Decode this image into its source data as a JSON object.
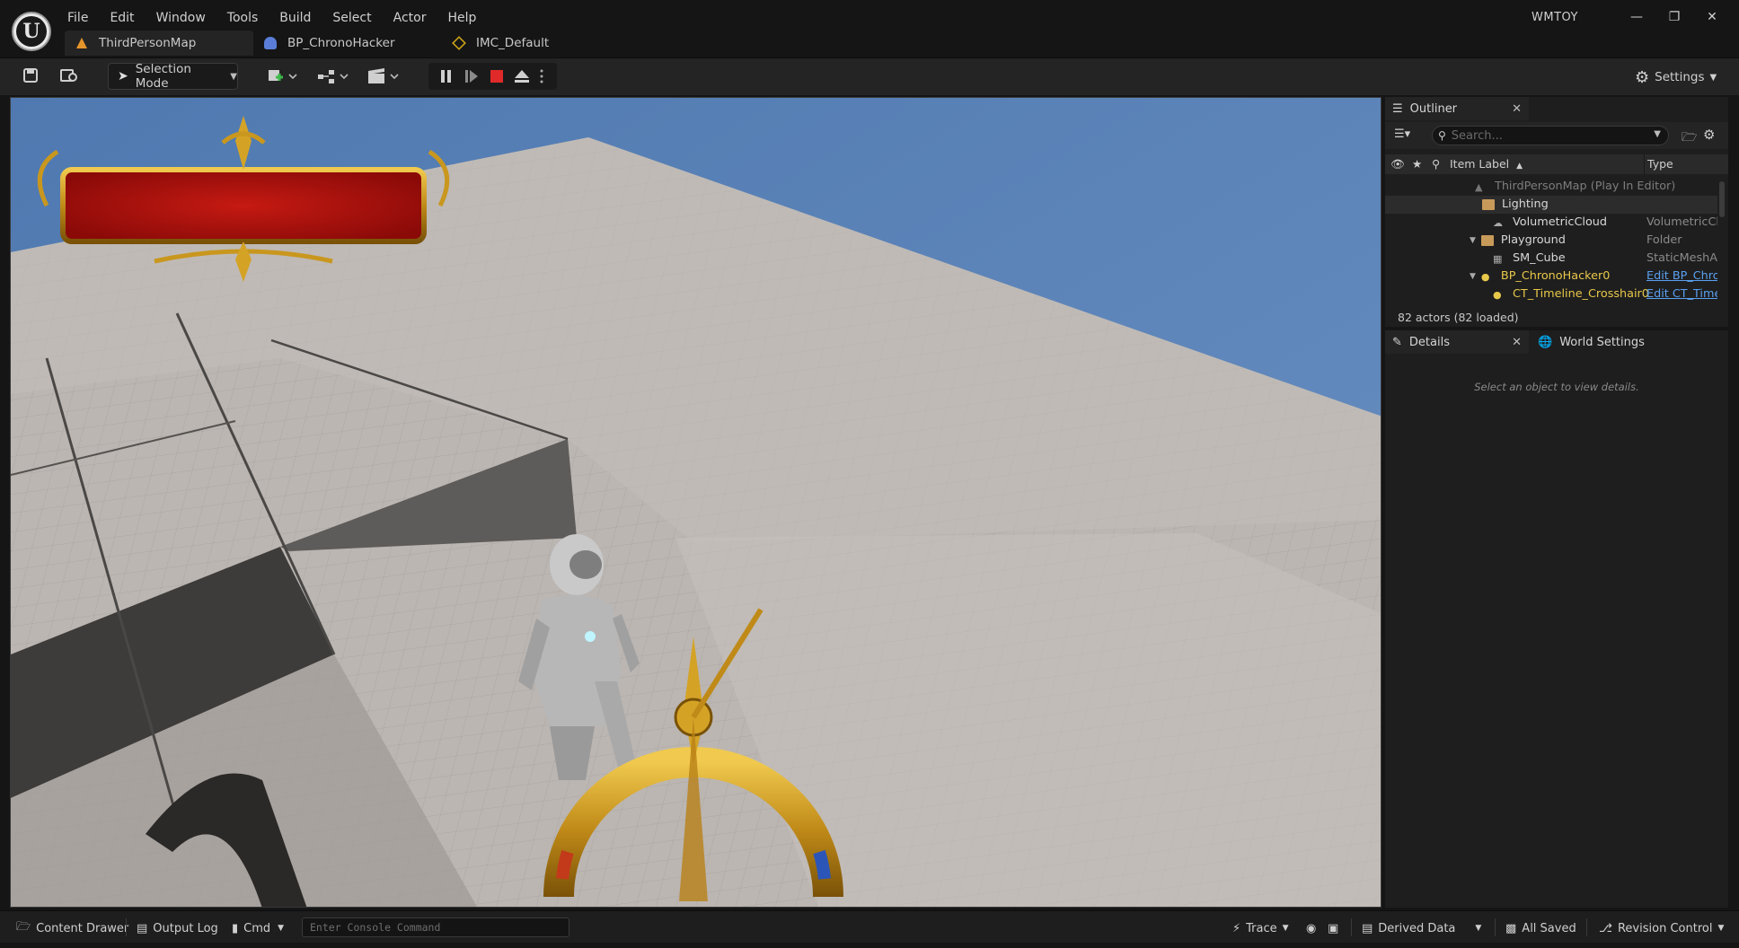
{
  "app": {
    "name": "WMTOY",
    "menu": [
      "File",
      "Edit",
      "Window",
      "Tools",
      "Build",
      "Select",
      "Actor",
      "Help"
    ]
  },
  "tabs": [
    {
      "label": "ThirdPersonMap",
      "icon": "map-icon",
      "active": true
    },
    {
      "label": "BP_ChronoHacker",
      "icon": "blueprint-icon",
      "active": false
    },
    {
      "label": "IMC_Default",
      "icon": "input-mapping-icon",
      "active": false
    }
  ],
  "toolbar": {
    "selection_mode": "Selection Mode",
    "settings": "Settings"
  },
  "outliner": {
    "title": "Outliner",
    "search_placeholder": "Search...",
    "col_label": "Item Label",
    "col_sort": "▲",
    "col_type": "Type",
    "rows": [
      {
        "label": "ThirdPersonMap (Play In Editor)",
        "type": ""
      },
      {
        "label": "Lighting",
        "type": ""
      },
      {
        "label": "VolumetricCloud",
        "type": "VolumetricCloud"
      },
      {
        "label": "Playground",
        "type": "Folder"
      },
      {
        "label": "SM_Cube",
        "type": "StaticMeshActor"
      },
      {
        "label": "BP_ChronoHacker0",
        "type": "Edit BP_ChronoHacker"
      },
      {
        "label": "CT_Timeline_Crosshair0",
        "type": "Edit CT_Timeline"
      }
    ],
    "footer": "82 actors (82 loaded)"
  },
  "details": {
    "title": "Details",
    "world_settings": "World Settings",
    "empty_message": "Select an object to view details."
  },
  "statusbar": {
    "content_drawer": "Content Drawer",
    "output_log": "Output Log",
    "cmd": "Cmd",
    "console_placeholder": "Enter Console Command",
    "trace": "Trace",
    "derived_data": "Derived Data",
    "all_saved": "All Saved",
    "revision_control": "Revision Control"
  },
  "colors": {
    "accent_link": "#5aa0f0",
    "stop_red": "#e02a2a",
    "sky": "#5b84b8",
    "floor": "#b9b4b0",
    "gold": "#c9971e",
    "banner_red": "#b00f0f"
  }
}
